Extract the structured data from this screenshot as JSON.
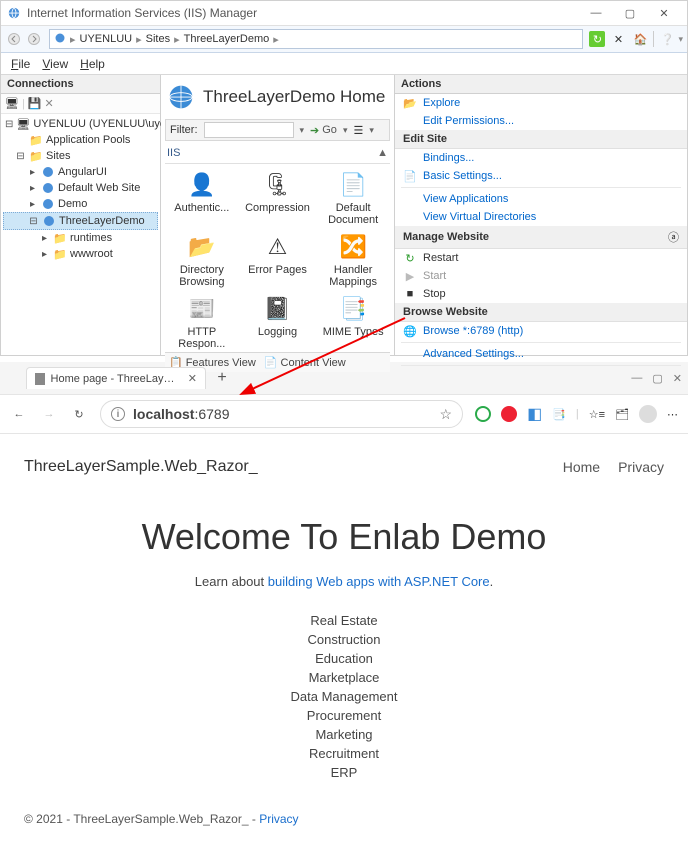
{
  "iis": {
    "title": "Internet Information Services (IIS) Manager",
    "breadcrumb": {
      "root": "UYENLUU",
      "sites": "Sites",
      "site": "ThreeLayerDemo"
    },
    "menu": {
      "file": "File",
      "view": "View",
      "help": "Help"
    },
    "connections_label": "Connections",
    "tree": {
      "server": "UYENLUU (UYENLUU\\uyen.luu",
      "app_pools": "Application Pools",
      "sites": "Sites",
      "site_angular": "AngularUI",
      "site_default": "Default Web Site",
      "site_demo": "Demo",
      "site_three": "ThreeLayerDemo",
      "folder_runtimes": "runtimes",
      "folder_wwwroot": "wwwroot"
    },
    "center": {
      "title": "ThreeLayerDemo Home",
      "filter_label": "Filter:",
      "go": "Go",
      "group_iis": "IIS",
      "features": [
        {
          "label": "Authentic..."
        },
        {
          "label": "Compression"
        },
        {
          "label": "Default Document"
        },
        {
          "label": "Directory Browsing"
        },
        {
          "label": "Error Pages"
        },
        {
          "label": "Handler Mappings"
        },
        {
          "label": "HTTP Respon..."
        },
        {
          "label": "Logging"
        },
        {
          "label": "MIME Types"
        }
      ],
      "tab_features": "Features View",
      "tab_content": "Content View"
    },
    "actions": {
      "header": "Actions",
      "explore": "Explore",
      "edit_perm": "Edit Permissions...",
      "edit_site": "Edit Site",
      "bindings": "Bindings...",
      "basic": "Basic Settings...",
      "view_apps": "View Applications",
      "view_vdirs": "View Virtual Directories",
      "manage": "Manage Website",
      "restart": "Restart",
      "start": "Start",
      "stop": "Stop",
      "browse_hdr": "Browse Website",
      "browse": "Browse *:6789 (http)",
      "advanced": "Advanced Settings..."
    }
  },
  "browser": {
    "tab_title": "Home page - ThreeLayerSample",
    "address": "localhost:6789",
    "nav": {
      "brand": "ThreeLayerSample.Web_Razor_",
      "home": "Home",
      "privacy": "Privacy"
    },
    "hero_title": "Welcome To Enlab Demo",
    "lead_pre": "Learn about ",
    "lead_link": "building Web apps with ASP.NET Core",
    "lead_post": ".",
    "categories": [
      "Real Estate",
      "Construction",
      "Education",
      "Marketplace",
      "Data Management",
      "Procurement",
      "Marketing",
      "Recruitment",
      "ERP"
    ],
    "footer_pre": "© 2021 - ThreeLayerSample.Web_Razor_ - ",
    "footer_link": "Privacy"
  }
}
